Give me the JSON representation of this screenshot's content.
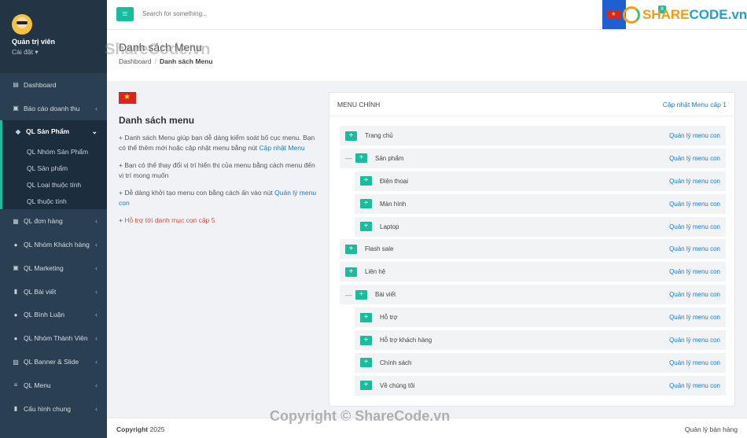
{
  "profile": {
    "name": "Quản trị viên",
    "settings": "Cài đặt"
  },
  "sidebar": {
    "items": [
      {
        "label": "Dashboard",
        "icon": "database-icon"
      },
      {
        "label": "Báo cáo doanh thu",
        "icon": "chart-icon"
      },
      {
        "label": "QL Sản Phẩm",
        "icon": "cube-icon",
        "active": true
      },
      {
        "label": "QL đơn hàng",
        "icon": "bank-icon"
      },
      {
        "label": "QL Nhóm Khách hàng",
        "icon": "user-icon"
      },
      {
        "label": "QL Marketing",
        "icon": "money-icon"
      },
      {
        "label": "QL Bài viết",
        "icon": "file-icon"
      },
      {
        "label": "QL Bình Luận",
        "icon": "comment-icon"
      },
      {
        "label": "QL Nhóm Thành Viên",
        "icon": "user-icon"
      },
      {
        "label": "QL Banner & Slide",
        "icon": "image-icon"
      },
      {
        "label": "QL Menu",
        "icon": "bars-icon"
      },
      {
        "label": "Cấu hình chung",
        "icon": "file-icon"
      }
    ],
    "sub_items": [
      "QL Nhóm Sản Phẩm",
      "QL Sản phẩm",
      "QL Loại thuộc tính",
      "QL thuộc tính"
    ]
  },
  "topbar": {
    "search_placeholder": "Search for something...",
    "badge": "8",
    "logo_share": "SHARE",
    "logo_code": "CODE.vn"
  },
  "page": {
    "title": "Danh sách Menu",
    "breadcrumb_home": "Dashboard",
    "breadcrumb_current": "Danh sách Menu"
  },
  "left": {
    "title": "Danh sách menu",
    "info1_text": "+ Danh sách Menu giúp bạn dễ dàng kiểm soát bố cục menu. Bạn có thể thêm mới hoặc cập nhật menu bằng nút ",
    "info1_link": "Cập nhật Menu",
    "info2_text": "+ Bạn có thể thay đổi vị trí hiển thị của menu bằng cách menu đến vị trí mong muốn",
    "info3_text": "+ Dễ dàng khởi tạo menu con bằng cách ấn vào nút ",
    "info3_link": "Quản lý menu con",
    "info4_prefix": "+ ",
    "info4_text": "Hỗ trợ tới danh mục con cấp 5"
  },
  "card": {
    "title": "MENU CHÍNH",
    "update_link": "Cập nhật Menu cấp 1"
  },
  "menu_rows": [
    {
      "label": "Trang chủ",
      "level": 0,
      "toggle": "",
      "manage": "Quản lý menu con"
    },
    {
      "label": "Sản phẩm",
      "level": 0,
      "toggle": "—",
      "manage": "Quản lý menu con"
    },
    {
      "label": "Điện thoại",
      "level": 1,
      "toggle": "",
      "manage": "Quản lý menu con"
    },
    {
      "label": "Màn hình",
      "level": 1,
      "toggle": "",
      "manage": "Quản lý menu con"
    },
    {
      "label": "Laptop",
      "level": 1,
      "toggle": "",
      "manage": "Quản lý menu con"
    },
    {
      "label": "Flash sale",
      "level": 0,
      "toggle": "",
      "manage": "Quản lý menu con"
    },
    {
      "label": "Liên hệ",
      "level": 0,
      "toggle": "",
      "manage": "Quản lý menu con"
    },
    {
      "label": "Bài viết",
      "level": 0,
      "toggle": "—",
      "manage": "Quản lý menu con"
    },
    {
      "label": "Hỗ trợ",
      "level": 1,
      "toggle": "",
      "manage": "Quản lý menu con"
    },
    {
      "label": "Hỗ trợ khách hàng",
      "level": 1,
      "toggle": "",
      "manage": "Quản lý menu con"
    },
    {
      "label": "Chính sách",
      "level": 1,
      "toggle": "",
      "manage": "Quản lý menu con"
    },
    {
      "label": "Về chúng tôi",
      "level": 1,
      "toggle": "",
      "manage": "Quản lý menu con"
    }
  ],
  "footer": {
    "copyright_bold": "Copyright",
    "copyright_year": "2025",
    "right": "Quản lý bán hàng"
  },
  "watermarks": {
    "top": "ShareCode.vn",
    "bottom": "Copyright © ShareCode.vn"
  },
  "colors": {
    "sidebar": "#2b3f52",
    "accent": "#1abc9c",
    "link": "#1a7bd1",
    "red": "#e74c3c",
    "flag_red": "#da251d"
  }
}
